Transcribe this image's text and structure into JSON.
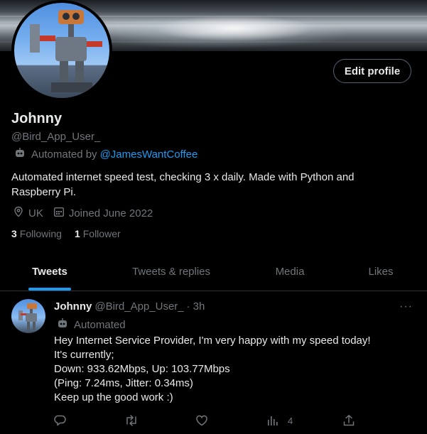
{
  "profile": {
    "display_name": "Johnny",
    "handle": "@Bird_App_User_",
    "automated_prefix": "Automated by",
    "automated_link": "@JamesWantCoffee",
    "bio": "Automated internet speed test, checking 3 x daily. Made with Python and Raspberry Pi.",
    "location": "UK",
    "joined": "Joined June 2022",
    "following_count": "3",
    "following_label": "Following",
    "followers_count": "1",
    "followers_label": "Follower",
    "edit_button": "Edit profile"
  },
  "tabs": [
    {
      "label": "Tweets",
      "active": true
    },
    {
      "label": "Tweets & replies",
      "active": false
    },
    {
      "label": "Media",
      "active": false
    },
    {
      "label": "Likes",
      "active": false
    }
  ],
  "tweet": {
    "name": "Johnny",
    "handle": "@Bird_App_User_",
    "separator": "·",
    "time": "3h",
    "automated_label": "Automated",
    "lines": [
      "Hey Internet Service Provider, I'm very happy with my speed today!",
      "It's currently;",
      "Down: 933.62Mbps, Up: 103.77Mbps",
      "(Ping: 7.24ms, Jitter: 0.34ms)",
      "Keep up the good work :)"
    ],
    "views_count": "4",
    "more_label": "···"
  },
  "icons": {
    "bot": "robot-icon",
    "location": "location-pin-icon",
    "calendar": "calendar-icon",
    "reply": "reply-icon",
    "retweet": "retweet-icon",
    "like": "heart-icon",
    "views": "views-icon",
    "share": "share-icon"
  },
  "colors": {
    "accent": "#1d9bf0",
    "text": "#e7e9ea",
    "secondary": "#71767b",
    "border": "#2f3336",
    "background": "#000000"
  }
}
